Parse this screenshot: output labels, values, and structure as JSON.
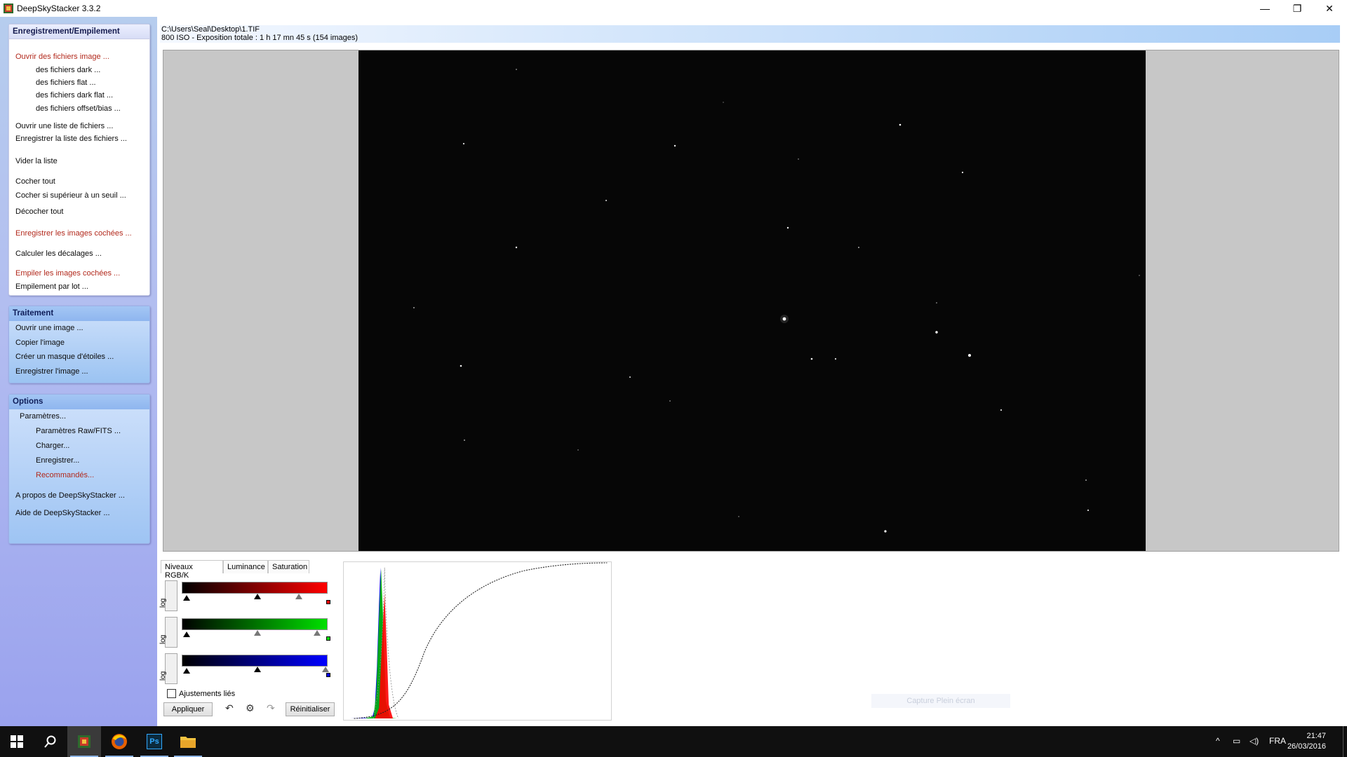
{
  "window": {
    "title": "DeepSkyStacker 3.3.2",
    "minimize": "—",
    "restore": "❐",
    "close": "✕"
  },
  "registering": {
    "title": "Enregistrement/Empilement",
    "open_images": "Ouvrir des fichiers image ...",
    "dark_files": "des fichiers dark ...",
    "flat_files": "des fichiers flat ...",
    "dark_flat_files": "des fichiers dark flat ...",
    "offset_files": "des fichiers offset/bias ...",
    "open_list": "Ouvrir une liste de fichiers ...",
    "save_list": "Enregistrer la liste des fichiers ...",
    "clear_list": "Vider la liste",
    "check_all": "Cocher tout",
    "check_above": "Cocher si supérieur à un seuil ...",
    "uncheck_all": "Décocher tout",
    "register_checked": "Enregistrer les images cochées ...",
    "compute_offsets": "Calculer les décalages ...",
    "stack_checked": "Empiler les images cochées ...",
    "batch_stacking": "Empilement par lot ..."
  },
  "processing": {
    "title": "Traitement",
    "open_image": "Ouvrir une image ...",
    "copy_image": "Copier l'image",
    "star_mask": "Créer un masque d'étoiles ...",
    "save_image": "Enregistrer l'image ..."
  },
  "options": {
    "title": "Options",
    "parameters": "Paramètres...",
    "raw_fits": "Paramètres Raw/FITS ...",
    "load": "Charger...",
    "save": "Enregistrer...",
    "recommended": "Recommandés...",
    "about": "A propos de DeepSkyStacker ...",
    "help": "Aide de DeepSkyStacker ..."
  },
  "info": {
    "file_path": "C:\\Users\\Seal\\Desktop\\1.TIF",
    "details": "800 ISO - Exposition totale : 1 h 17 mn 45 s (154 images)"
  },
  "adjust": {
    "tabs": [
      "Niveaux RGB/K",
      "Luminance",
      "Saturation"
    ],
    "log_label": "log",
    "linked_label": "Ajustements liés",
    "linked_checked": false,
    "apply": "Appliquer",
    "reset": "Réinitialiser",
    "red_levels": [
      0.0,
      0.49,
      0.77
    ],
    "green_levels": [
      0.0,
      0.49,
      0.91
    ],
    "blue_levels": [
      0.0,
      0.49,
      0.97
    ]
  },
  "ghost_button": "Capture Plein écran",
  "taskbar": {
    "language": "FRA",
    "time": "21:47",
    "date": "26/03/2016",
    "ps_label": "Ps"
  },
  "colors": {
    "red_channel": "#ff0000",
    "green_channel": "#00e000",
    "blue_channel": "#0000ff",
    "menu_red": "#b2291c",
    "taskbar": "#101010"
  }
}
